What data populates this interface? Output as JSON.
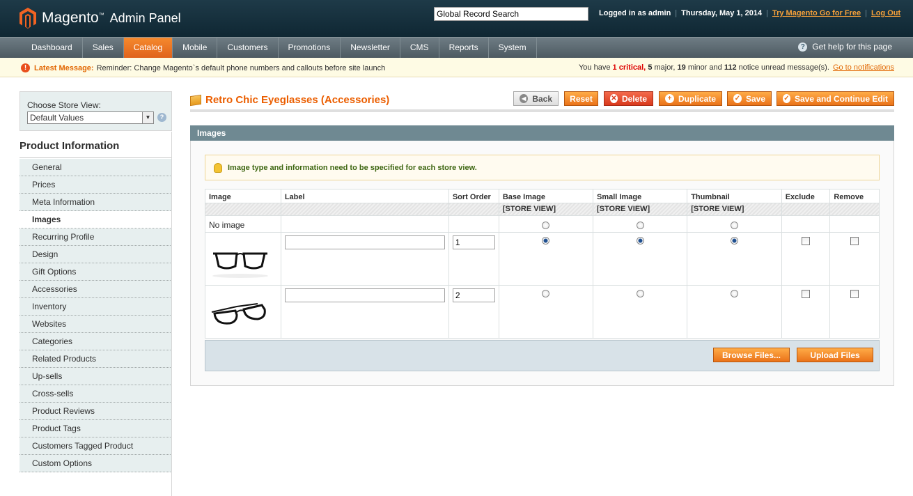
{
  "header": {
    "logo_brand": "Magento",
    "logo_sub": "Admin Panel",
    "search_value": "Global Record Search",
    "logged_in": "Logged in as admin",
    "date": "Thursday, May 1, 2014",
    "try_link": "Try Magento Go for Free",
    "logout": "Log Out"
  },
  "nav": {
    "items": [
      "Dashboard",
      "Sales",
      "Catalog",
      "Mobile",
      "Customers",
      "Promotions",
      "Newsletter",
      "CMS",
      "Reports",
      "System"
    ],
    "active": "Catalog",
    "help": "Get help for this page"
  },
  "message": {
    "title": "Latest Message:",
    "text": "Reminder: Change Magento`s default phone numbers and callouts before site launch",
    "summary_prefix": "You have",
    "critical_count": "1",
    "critical_label": "critical,",
    "major_count": "5",
    "major_label": "major,",
    "minor_count": "19",
    "minor_label": "minor and",
    "notice_count": "112",
    "notice_label": "notice unread message(s).",
    "link": "Go to notifications"
  },
  "sidebar": {
    "store_label": "Choose Store View:",
    "store_value": "Default Values",
    "title": "Product Information",
    "items": [
      "General",
      "Prices",
      "Meta Information",
      "Images",
      "Recurring Profile",
      "Design",
      "Gift Options",
      "Accessories",
      "Inventory",
      "Websites",
      "Categories",
      "Related Products",
      "Up-sells",
      "Cross-sells",
      "Product Reviews",
      "Product Tags",
      "Customers Tagged Product",
      "Custom Options"
    ],
    "active": "Images"
  },
  "page": {
    "title": "Retro Chic Eyeglasses (Accessories)",
    "buttons": {
      "back": "Back",
      "reset": "Reset",
      "delete": "Delete",
      "duplicate": "Duplicate",
      "save": "Save",
      "save_continue": "Save and Continue Edit"
    }
  },
  "images": {
    "section_title": "Images",
    "notice": "Image type and information need to be specified for each store view.",
    "columns": [
      "Image",
      "Label",
      "Sort Order",
      "Base Image",
      "Small Image",
      "Thumbnail",
      "Exclude",
      "Remove"
    ],
    "scope_label": "[STORE VIEW]",
    "no_image": "No image",
    "rows": [
      {
        "label": "",
        "sort_order": "1",
        "base": true,
        "small": true,
        "thumb": true,
        "exclude": false,
        "remove": false
      },
      {
        "label": "",
        "sort_order": "2",
        "base": false,
        "small": false,
        "thumb": false,
        "exclude": false,
        "remove": false
      }
    ],
    "browse": "Browse Files...",
    "upload": "Upload Files"
  },
  "colors": {
    "accent": "#ea7219",
    "header_bg": "#0f2733",
    "title": "#eb5e00"
  }
}
